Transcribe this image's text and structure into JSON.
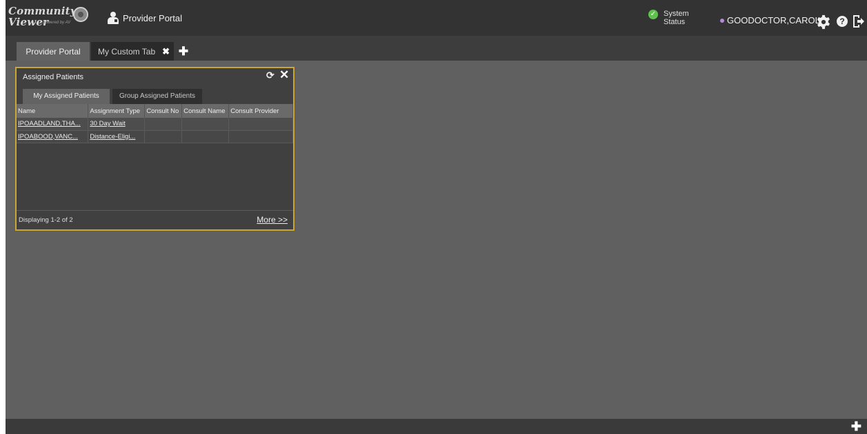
{
  "header": {
    "logo_line1": "Community",
    "logo_line2": "Viewer",
    "logo_powered": "powered by AV",
    "portal_label": "Provider Portal",
    "system_status_line1": "System",
    "system_status_line2": "Status",
    "user_name": "GOODOCTOR,CAROL"
  },
  "tabs": {
    "provider": "Provider Portal",
    "custom": "My Custom Tab",
    "close_glyph": "✖",
    "add_glyph": "✚"
  },
  "widget": {
    "title": "Assigned Patients",
    "tabs": [
      "My Assigned Patients",
      "Group Assigned Patients"
    ],
    "columns": [
      "Name",
      "Assignment Type",
      "Consult No",
      "Consult Name",
      "Consult Provider"
    ],
    "rows": [
      {
        "name": "IPOAADLAND,THA...",
        "type": "30 Day Wait",
        "consult_no": "",
        "consult_name": "",
        "consult_provider": ""
      },
      {
        "name": "IPOABOOD,VANC...",
        "type": "Distance-Eligi...",
        "consult_no": "",
        "consult_name": "",
        "consult_provider": ""
      }
    ],
    "displaying": "Displaying 1-2 of 2",
    "more": "More >>"
  },
  "footer": {
    "add_glyph": "✚"
  },
  "icons": {
    "status_icon": "check-circle-icon",
    "user_status_dot_color": "#b58ad6",
    "focus_border_color": "#c9a732"
  }
}
